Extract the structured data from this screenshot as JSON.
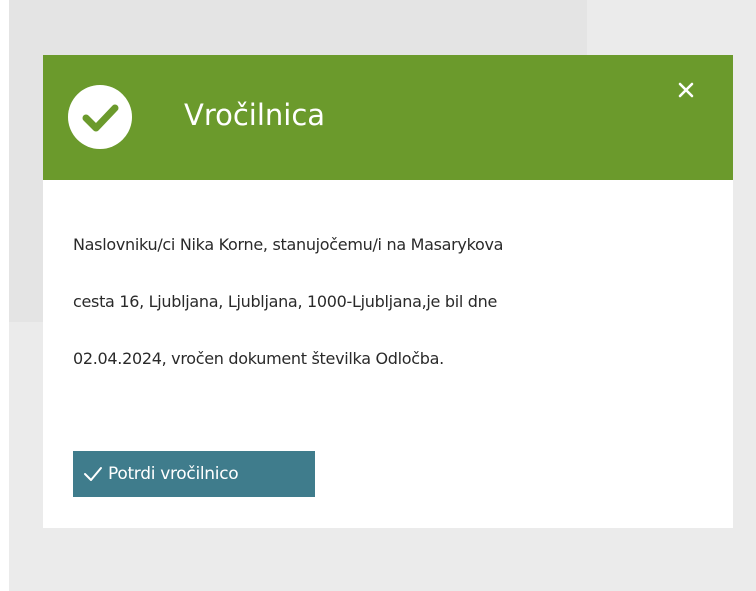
{
  "colors": {
    "header_green": "#6b9a2c",
    "button_teal": "#3f7c8c",
    "backdrop_gray": "#ebebeb"
  },
  "icons": {
    "status": "check-circle-icon",
    "close": "close-icon",
    "button": "checkmark-icon"
  },
  "dialog": {
    "title": "Vročilnica",
    "close_label": "×",
    "message_lines": [
      "Naslovniku/ci Nika Korne, stanujočemu/i na Masarykova",
      "cesta 16, Ljubljana, Ljubljana, 1000-Ljubljana,je bil dne",
      "02.04.2024, vročen dokument številka Odločba."
    ],
    "confirm_label": "Potrdi vročilnico"
  }
}
